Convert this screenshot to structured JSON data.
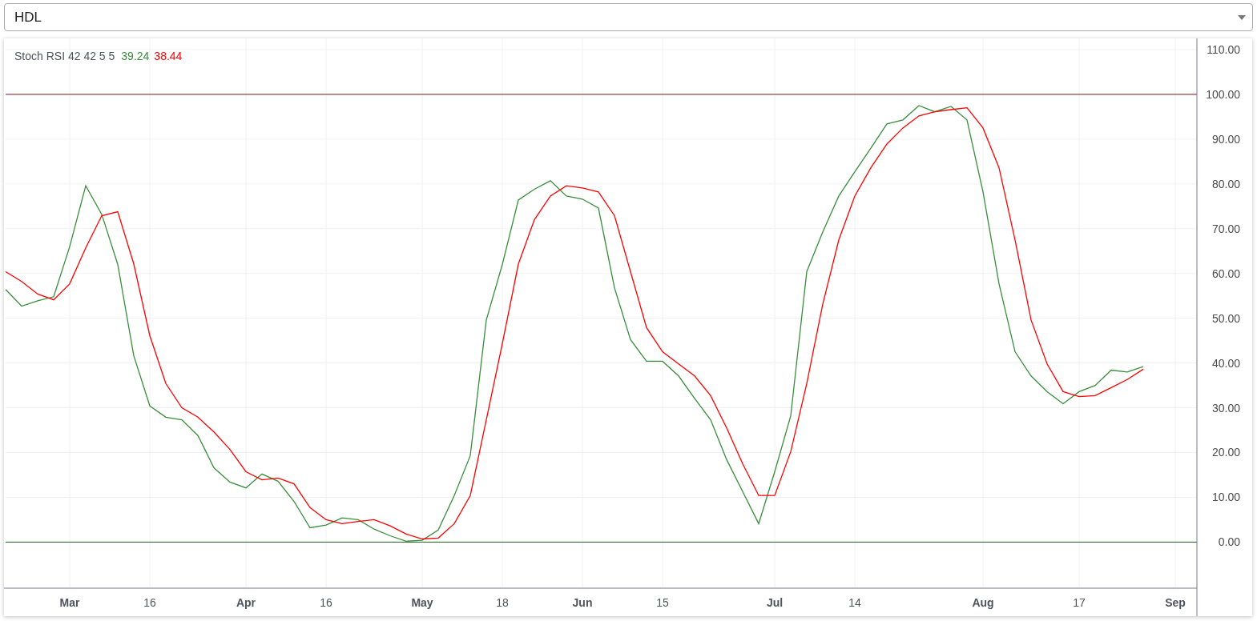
{
  "symbol_select": {
    "value": "HDL"
  },
  "legend": {
    "label": "Stoch RSI 42 42 5 5",
    "values": [
      {
        "text": "39.24",
        "color": "#388e3c"
      },
      {
        "text": "38.44",
        "color": "#ff0000"
      }
    ]
  },
  "x_label_styles": [
    {
      "bold": true
    },
    {
      "bold": false
    },
    {
      "bold": true
    },
    {
      "bold": false
    },
    {
      "bold": true
    },
    {
      "bold": false
    },
    {
      "bold": true
    },
    {
      "bold": false
    },
    {
      "bold": true
    },
    {
      "bold": false
    },
    {
      "bold": true
    },
    {
      "bold": false
    },
    {
      "bold": true
    }
  ],
  "chart_data": {
    "type": "line",
    "ylim": [
      -10.3,
      112.5
    ],
    "grid": true,
    "yticks": [
      {
        "value": 0,
        "label": "0.00"
      },
      {
        "value": 10,
        "label": "10.00"
      },
      {
        "value": 20,
        "label": "20.00"
      },
      {
        "value": 30,
        "label": "30.00"
      },
      {
        "value": 40,
        "label": "40.00"
      },
      {
        "value": 50,
        "label": "50.00"
      },
      {
        "value": 60,
        "label": "60.00"
      },
      {
        "value": 70,
        "label": "70.00"
      },
      {
        "value": 80,
        "label": "80.00"
      },
      {
        "value": 90,
        "label": "90.00"
      },
      {
        "value": 100,
        "label": "100.00"
      },
      {
        "value": 110,
        "label": "110.00"
      }
    ],
    "categories": [
      null,
      null,
      null,
      null,
      "Mar",
      null,
      null,
      null,
      null,
      "16",
      null,
      null,
      null,
      null,
      null,
      "Apr",
      null,
      null,
      null,
      null,
      "16",
      null,
      null,
      null,
      null,
      null,
      "May",
      null,
      null,
      null,
      null,
      "18",
      null,
      null,
      null,
      null,
      "Jun",
      null,
      null,
      null,
      null,
      "15",
      null,
      null,
      null,
      null,
      null,
      null,
      "Jul",
      null,
      null,
      null,
      null,
      "14",
      null,
      null,
      null,
      null,
      null,
      null,
      null,
      "Aug",
      null,
      null,
      null,
      null,
      null,
      "17",
      null,
      null,
      null,
      null,
      null,
      "Sep",
      null
    ],
    "series": [
      {
        "color": "#388e3c",
        "values": [
          56.4,
          52.7,
          53.9,
          54.8,
          66,
          79.6,
          73.2,
          62,
          41.6,
          30.4,
          27.9,
          27.3,
          23.8,
          16.6,
          13.4,
          12.1,
          15.2,
          13.6,
          9.1,
          3.2,
          3.8,
          5.4,
          5,
          2.9,
          1.4,
          0.2,
          0.4,
          2.7,
          10.4,
          19.3,
          49.6,
          62,
          76.4,
          78.8,
          80.7,
          77.3,
          76.6,
          74.6,
          56.8,
          45.2,
          40.4,
          40.4,
          37.1,
          32.1,
          27.3,
          18.4,
          11.3,
          4.1,
          15.7,
          28.2,
          60.4,
          69.3,
          77.3,
          82.7,
          88,
          93.4,
          94.3,
          97.5,
          96.1,
          97.3,
          94.3,
          78.2,
          57.7,
          42.5,
          37.1,
          33.6,
          30.9,
          33.6,
          35,
          38.4,
          38,
          39.2,
          null,
          null,
          null
        ]
      },
      {
        "color": "#ff0000",
        "values": [
          60.4,
          58.2,
          55.4,
          54.1,
          57.7,
          65.7,
          72.9,
          73.8,
          62.1,
          46.1,
          35.4,
          30,
          27.9,
          24.6,
          20.7,
          15.7,
          13.9,
          14.3,
          13,
          7.7,
          5,
          4.1,
          4.6,
          5,
          3.6,
          1.8,
          0.7,
          0.9,
          4.1,
          10.4,
          27.3,
          44.3,
          62.1,
          72,
          77.3,
          79.6,
          79.1,
          78.2,
          72.9,
          60.4,
          47.9,
          42.5,
          39.8,
          37.1,
          32.7,
          25.5,
          17.5,
          10.4,
          10.4,
          20.2,
          35.4,
          53.2,
          67.5,
          77.3,
          83.6,
          88.9,
          92.5,
          95.2,
          96.1,
          96.6,
          97,
          92.5,
          83.6,
          67.5,
          49.6,
          39.8,
          33.6,
          32.5,
          32.7,
          34.5,
          36.3,
          38.6,
          null,
          null,
          null
        ]
      }
    ],
    "ref_lines": [
      {
        "axis": "y",
        "value": 100,
        "color": "#7a1e1e"
      },
      {
        "axis": "y",
        "value": 0,
        "color": "#1b5e20"
      }
    ]
  }
}
